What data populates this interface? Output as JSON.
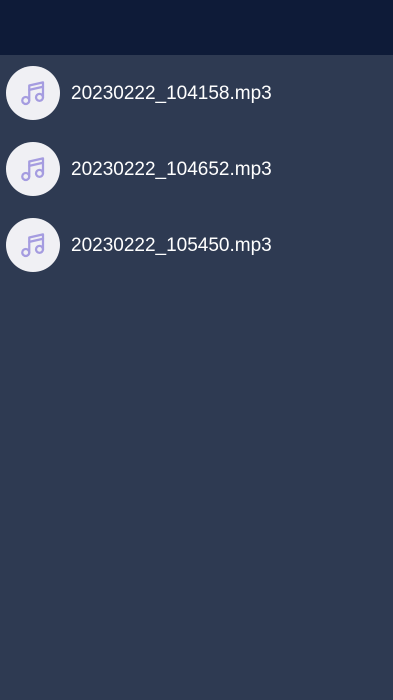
{
  "colors": {
    "background": "#2e3a52",
    "top_bar": "#0e1b38",
    "avatar_bg": "#f0f0f4",
    "icon": "#a59ce0",
    "text": "#ffffff"
  },
  "files": [
    {
      "name": "20230222_104158.mp3",
      "icon": "music-note-icon"
    },
    {
      "name": "20230222_104652.mp3",
      "icon": "music-note-icon"
    },
    {
      "name": "20230222_105450.mp3",
      "icon": "music-note-icon"
    }
  ]
}
